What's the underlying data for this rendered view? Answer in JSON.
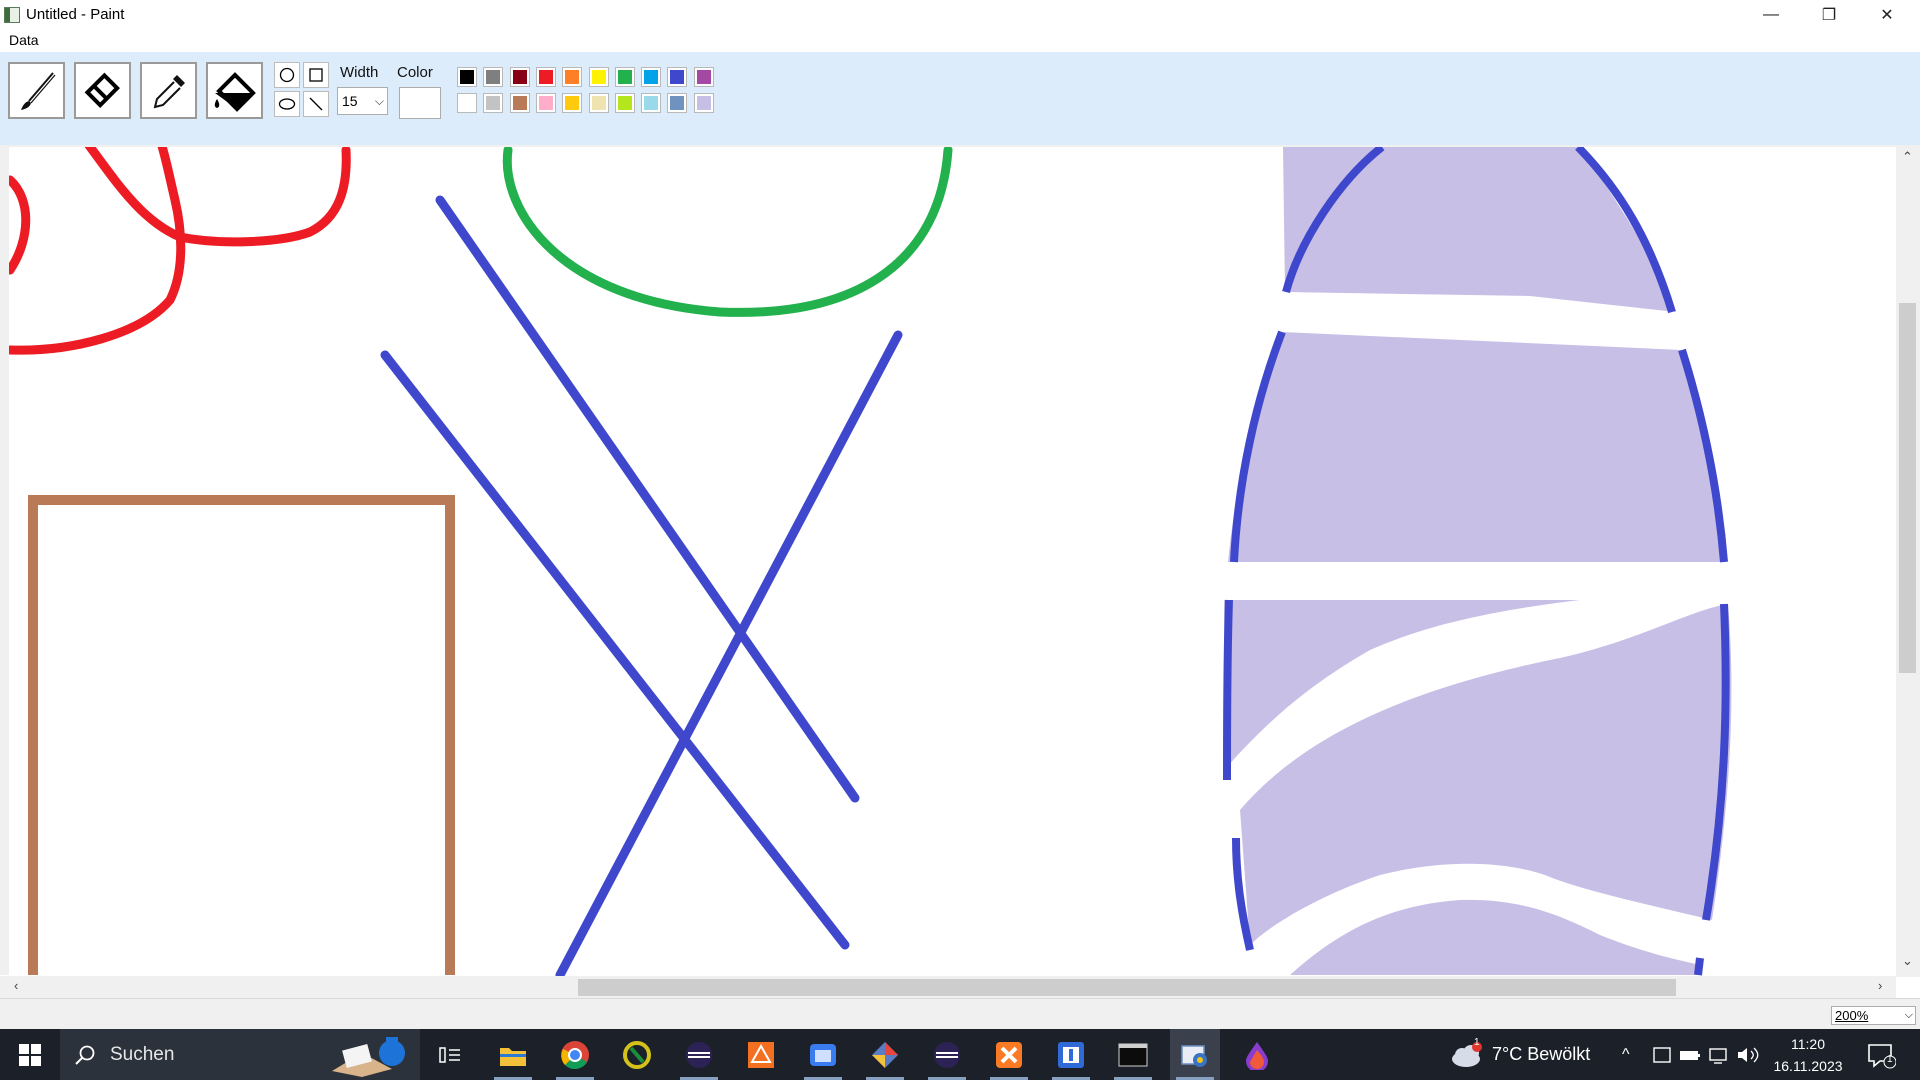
{
  "window": {
    "title": "Untitled - Paint",
    "minimize_symbol": "—",
    "restore_symbol": "❐",
    "close_symbol": "✕"
  },
  "menu": {
    "items": [
      "Data"
    ]
  },
  "toolbar": {
    "tools": [
      "brush-icon",
      "eraser-icon",
      "eyedropper-icon",
      "fill-bucket-icon"
    ],
    "shapes": [
      "circle-icon",
      "rectangle-icon",
      "ellipse-icon",
      "line-icon"
    ],
    "width_label": "Width",
    "width_value": "15",
    "color_label": "Color",
    "current_color": "#ffffff",
    "palette_row1": [
      "#000000",
      "#7f7f7f",
      "#880015",
      "#ed1c24",
      "#ff7f27",
      "#fff200",
      "#22b14c",
      "#00a2e8",
      "#3f48cc",
      "#a349a4"
    ],
    "palette_row2": [
      "#ffffff",
      "#c3c3c3",
      "#b97a57",
      "#ffaec9",
      "#ffc90e",
      "#efe4b0",
      "#b5e61d",
      "#99d9ea",
      "#7092be",
      "#c8bfe7"
    ]
  },
  "canvas": {
    "stroke_colors": {
      "red": "#ed1c24",
      "green": "#22b14c",
      "blue": "#3f48cc",
      "brown": "#b97a57",
      "lavender": "#c8bfe7"
    }
  },
  "statusbar": {
    "zoom": "200%"
  },
  "taskbar": {
    "search_placeholder": "Suchen",
    "apps": [
      "file-explorer-icon",
      "chrome-icon",
      "app-icon",
      "eclipse-icon",
      "app-icon",
      "files-icon",
      "git-icon",
      "eclipse-icon",
      "xampp-icon",
      "app-icon",
      "terminal-icon",
      "paint-icon",
      "drop-icon"
    ],
    "weather": "7°C  Bewölkt",
    "weather_badge": "1",
    "time": "11:20",
    "date": "16.11.2023",
    "notification_count": "1"
  }
}
